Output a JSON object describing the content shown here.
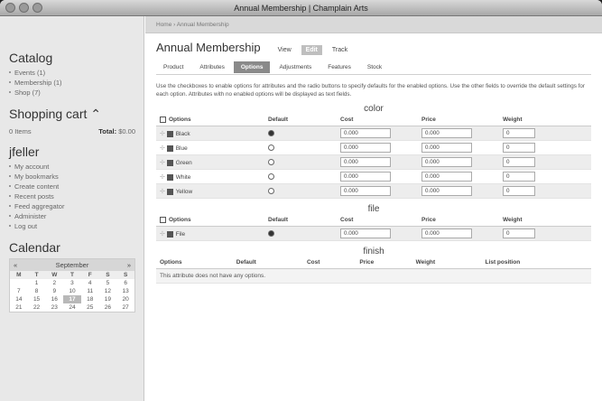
{
  "window": {
    "title": "Annual Membership | Champlain Arts"
  },
  "breadcrumb": "Home › Annual Membership",
  "sidebar": {
    "catalog_title": "Catalog",
    "catalog_items": [
      "Events (1)",
      "Membership (1)",
      "Shop (7)"
    ],
    "cart_title": "Shopping cart ⌃",
    "cart_items": "0 Items",
    "cart_total_label": "Total:",
    "cart_total_value": "$0.00",
    "user_title": "jfeller",
    "user_items": [
      "My account",
      "My bookmarks",
      "Create content",
      "Recent posts",
      "Feed aggregator",
      "Administer",
      "Log out"
    ],
    "calendar_title": "Calendar",
    "calendar": {
      "month": "September",
      "prev": "«",
      "next": "»",
      "dows": [
        "M",
        "T",
        "W",
        "T",
        "F",
        "S",
        "S"
      ],
      "weeks": [
        [
          "",
          "1",
          "2",
          "3",
          "4",
          "5",
          "6"
        ],
        [
          "7",
          "8",
          "9",
          "10",
          "11",
          "12",
          "13"
        ],
        [
          "14",
          "15",
          "16",
          "17",
          "18",
          "19",
          "20"
        ],
        [
          "21",
          "22",
          "23",
          "24",
          "25",
          "26",
          "27"
        ]
      ],
      "today": "17"
    }
  },
  "page": {
    "title": "Annual Membership",
    "mode_tabs": [
      "View",
      "Edit",
      "Track"
    ],
    "active_mode": "Edit",
    "subtabs": [
      "Product",
      "Attributes",
      "Options",
      "Adjustments",
      "Features",
      "Stock"
    ],
    "active_subtab": "Options",
    "intro": "Use the checkboxes to enable options for attributes and the radio buttons to specify defaults for the enabled options. Use the other fields to override the default settings for each option. Attributes with no enabled options will be displayed as text fields."
  },
  "columns": {
    "options": "Options",
    "default": "Default",
    "cost": "Cost",
    "price": "Price",
    "weight": "Weight",
    "list_position": "List position"
  },
  "attributes": {
    "color": {
      "title": "color",
      "rows": [
        {
          "name": "Black",
          "checked": true,
          "default": true,
          "cost": "0.000",
          "price": "0.000",
          "weight": "0"
        },
        {
          "name": "Blue",
          "checked": true,
          "default": false,
          "cost": "0.000",
          "price": "0.000",
          "weight": "0"
        },
        {
          "name": "Green",
          "checked": true,
          "default": false,
          "cost": "0.000",
          "price": "0.000",
          "weight": "0"
        },
        {
          "name": "White",
          "checked": true,
          "default": false,
          "cost": "0.000",
          "price": "0.000",
          "weight": "0"
        },
        {
          "name": "Yellow",
          "checked": true,
          "default": false,
          "cost": "0.000",
          "price": "0.000",
          "weight": "0"
        }
      ]
    },
    "file": {
      "title": "file",
      "rows": [
        {
          "name": "File",
          "checked": true,
          "default": true,
          "cost": "0.000",
          "price": "0.000",
          "weight": "0"
        }
      ]
    },
    "finish": {
      "title": "finish",
      "empty_message": "This attribute does not have any options."
    }
  }
}
